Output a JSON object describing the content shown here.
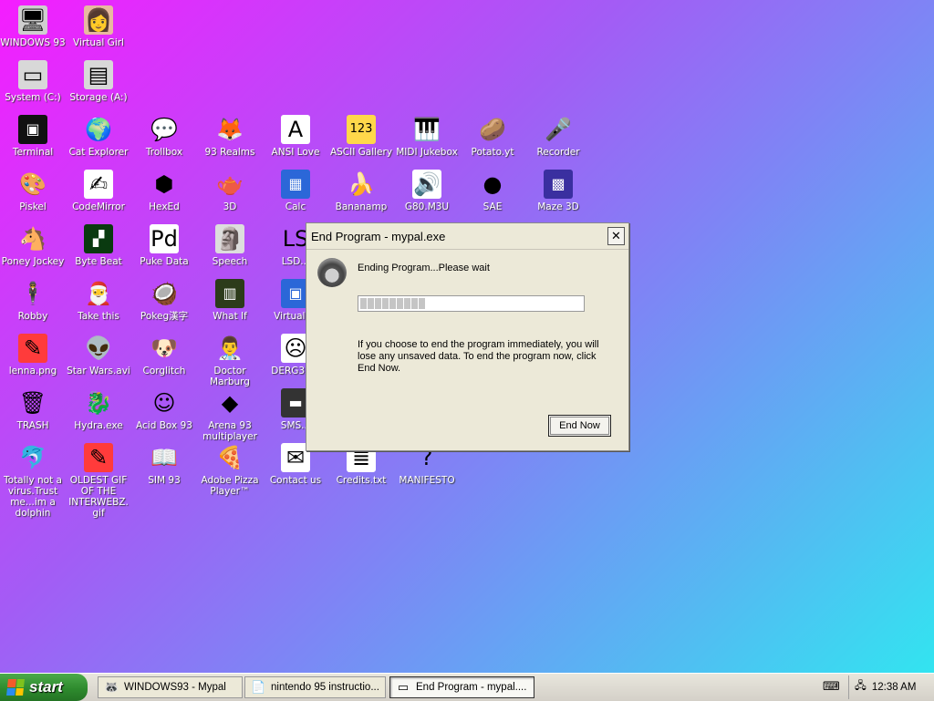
{
  "desktop": {
    "icons": [
      {
        "label": "WINDOWS 93",
        "glyph": "🖥",
        "bg": "#cfcfcf"
      },
      {
        "label": "Virtual Girl",
        "glyph": "👩",
        "bg": "#e8b9a0"
      },
      {
        "label": "System (C:)",
        "glyph": "▭",
        "bg": "#d8d8d8"
      },
      {
        "label": "Storage (A:)",
        "glyph": "▤",
        "bg": "#d8d8d8"
      },
      {
        "label": "Terminal",
        "glyph": "▣",
        "bg": "#111111"
      },
      {
        "label": "Cat Explorer",
        "glyph": "🌍",
        "bg": "transparent"
      },
      {
        "label": "Trollbox",
        "glyph": "💬",
        "bg": "transparent"
      },
      {
        "label": "93 Realms",
        "glyph": "🦊",
        "bg": "transparent"
      },
      {
        "label": "ANSI Love",
        "glyph": "A",
        "bg": "#ffffff"
      },
      {
        "label": "ASCII Gallery",
        "glyph": "123",
        "bg": "#ffd84a"
      },
      {
        "label": "MIDI Jukebox",
        "glyph": "🎹",
        "bg": "transparent"
      },
      {
        "label": "Potato.yt",
        "glyph": "🥔",
        "bg": "transparent"
      },
      {
        "label": "Recorder",
        "glyph": "🎤",
        "bg": "transparent"
      },
      {
        "label": "Piskel",
        "glyph": "🎨",
        "bg": "transparent"
      },
      {
        "label": "CodeMirror",
        "glyph": "✍",
        "bg": "#ffffff"
      },
      {
        "label": "HexEd",
        "glyph": "⬢",
        "bg": "transparent"
      },
      {
        "label": "3D",
        "glyph": "🫖",
        "bg": "transparent"
      },
      {
        "label": "Calc",
        "glyph": "▦",
        "bg": "#2b67d8"
      },
      {
        "label": "Bananamp",
        "glyph": "🍌",
        "bg": "transparent"
      },
      {
        "label": "G80.M3U",
        "glyph": "🔊",
        "bg": "#ffffff"
      },
      {
        "label": "SAE",
        "glyph": "●",
        "bg": "transparent"
      },
      {
        "label": "Maze 3D",
        "glyph": "▩",
        "bg": "#3a2fa0"
      },
      {
        "label": "Poney Jockey",
        "glyph": "🐴",
        "bg": "transparent"
      },
      {
        "label": "Byte Beat",
        "glyph": "▞",
        "bg": "#0a3a10"
      },
      {
        "label": "Puke Data",
        "glyph": "Pd",
        "bg": "#ffffff"
      },
      {
        "label": "Speech",
        "glyph": "🗿",
        "bg": "#dddddd"
      },
      {
        "label": "LSD...",
        "glyph": "LS",
        "bg": "transparent"
      },
      {
        "label": "Robby",
        "glyph": "🕴",
        "bg": "transparent"
      },
      {
        "label": "Take this",
        "glyph": "🎅",
        "bg": "transparent"
      },
      {
        "label": "Pokeg漢字",
        "glyph": "🥥",
        "bg": "transparent"
      },
      {
        "label": "What If",
        "glyph": "▥",
        "bg": "#2c3b1a"
      },
      {
        "label": "Virtual ...",
        "glyph": "▣",
        "bg": "#2b67d8"
      },
      {
        "label": "lenna.png",
        "glyph": "✎",
        "bg": "#ff3b3b"
      },
      {
        "label": "Star Wars.avi",
        "glyph": "👽",
        "bg": "transparent"
      },
      {
        "label": "Corglitch",
        "glyph": "🐶",
        "bg": "transparent"
      },
      {
        "label": "Doctor Marburg",
        "glyph": "👨‍⚕",
        "bg": "transparent"
      },
      {
        "label": "DERG32...",
        "glyph": "☹",
        "bg": "#ffffff"
      },
      {
        "label": "TRASH",
        "glyph": "🗑",
        "bg": "transparent"
      },
      {
        "label": "Hydra.exe",
        "glyph": "🐉",
        "bg": "transparent"
      },
      {
        "label": "Acid Box 93",
        "glyph": "☺",
        "bg": "transparent"
      },
      {
        "label": "Arena 93 multiplayer",
        "glyph": "◆",
        "bg": "transparent"
      },
      {
        "label": "SMS...",
        "glyph": "▬",
        "bg": "#333333"
      },
      {
        "label": "Totally not a virus.Trust me...im a dolphin",
        "glyph": "🐬",
        "bg": "transparent"
      },
      {
        "label": "OLDEST GIF OF THE INTERWEBZ.gif",
        "glyph": "✎",
        "bg": "#ff3b3b"
      },
      {
        "label": "SIM 93",
        "glyph": "📖",
        "bg": "transparent"
      },
      {
        "label": "Adobe Pizza Player™",
        "glyph": "🍕",
        "bg": "transparent"
      },
      {
        "label": "Contact us",
        "glyph": "✉",
        "bg": "#ffffff"
      },
      {
        "label": "Credits.txt",
        "glyph": "≣",
        "bg": "#ffffff"
      },
      {
        "label": "MANIFESTO",
        "glyph": "?",
        "bg": "transparent"
      }
    ]
  },
  "dialog": {
    "title": "End Program - mypal.exe",
    "close": "✕",
    "status": "Ending Program...Please wait",
    "progress_fraction": 0.3,
    "message": "If you choose to end the program immediately, you will lose any unsaved data. To end the program now, click End Now.",
    "end_now_label": "End Now"
  },
  "taskbar": {
    "start_label": "start",
    "tasks": [
      {
        "label": "WINDOWS93 - Mypal",
        "glyph": "🦝",
        "active": false
      },
      {
        "label": "nintendo 95 instructio...",
        "glyph": "📄",
        "active": false
      },
      {
        "label": "End Program - mypal....",
        "glyph": "▭",
        "active": true
      }
    ],
    "keyboard_icon": "⌨",
    "tray_icon": "🖧",
    "clock": "12:38 AM"
  }
}
